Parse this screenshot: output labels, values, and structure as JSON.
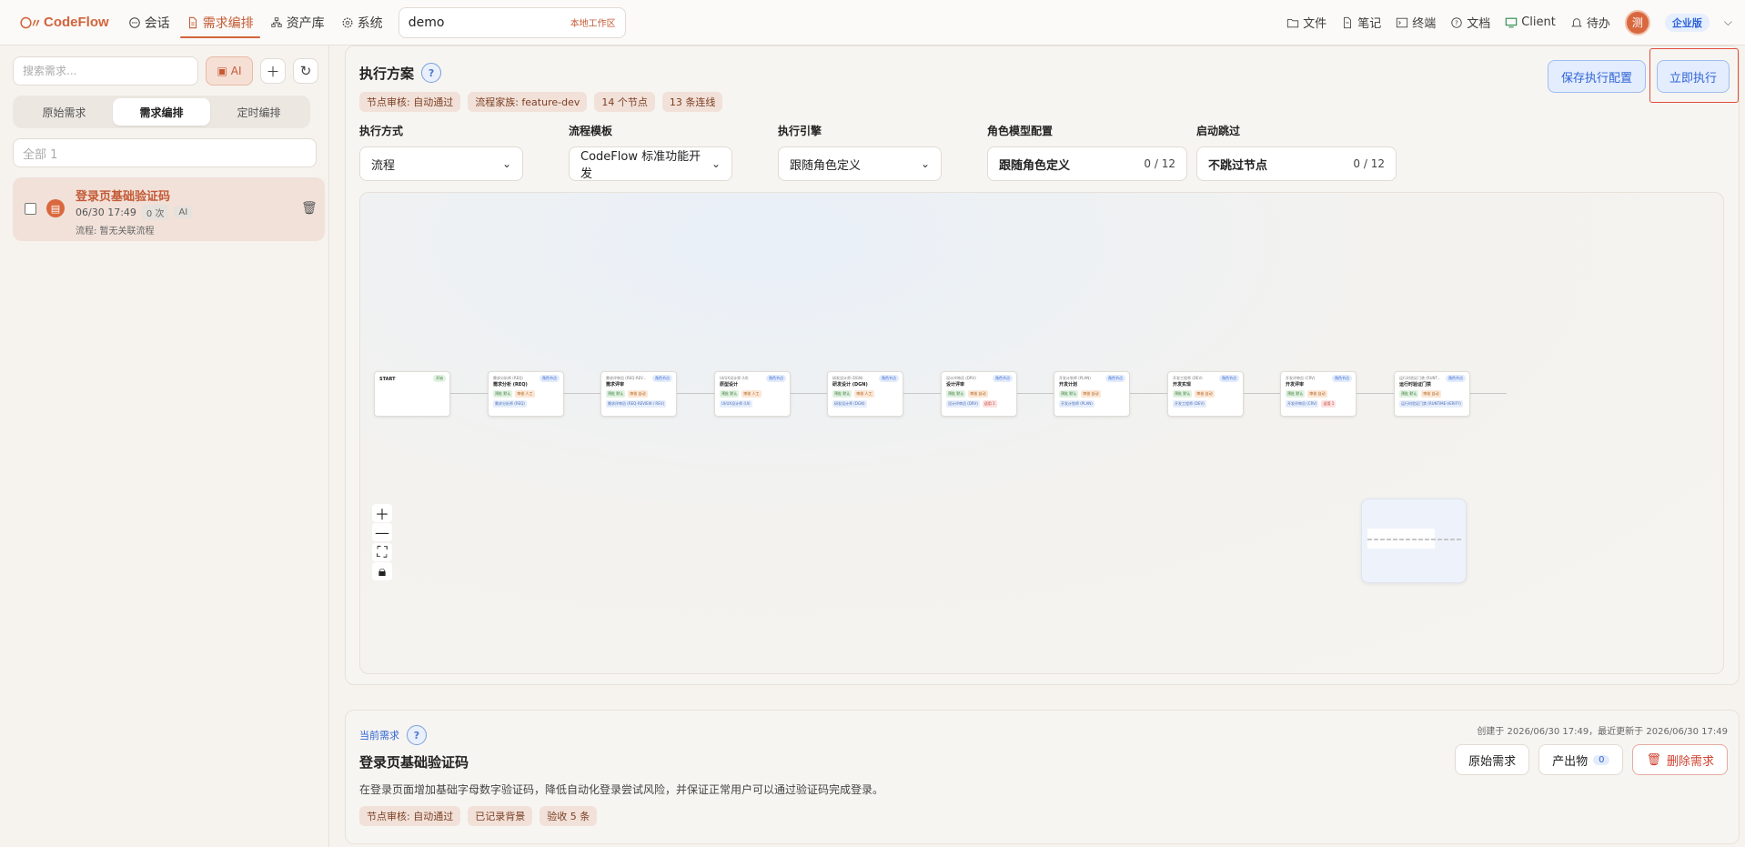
{
  "header": {
    "app_name": "CodeFlow",
    "nav": [
      {
        "label": "会话",
        "icon": "chat-icon"
      },
      {
        "label": "需求编排",
        "icon": "document-icon",
        "active": true
      },
      {
        "label": "资产库",
        "icon": "sitemap-icon"
      },
      {
        "label": "系统",
        "icon": "gear-icon"
      }
    ],
    "workspace": {
      "name": "demo",
      "tag": "本地工作区"
    },
    "tools": [
      {
        "label": "文件",
        "icon": "folder-icon"
      },
      {
        "label": "笔记",
        "icon": "note-icon"
      },
      {
        "label": "终端",
        "icon": "terminal-icon"
      },
      {
        "label": "文档",
        "icon": "help-icon"
      },
      {
        "label": "Client",
        "icon": "monitor-icon"
      },
      {
        "label": "待办",
        "icon": "bell-icon"
      }
    ],
    "avatar_text": "测",
    "edition": "企业版"
  },
  "sidebar": {
    "search_placeholder": "搜索需求...",
    "ai_label": "AI",
    "tabs": [
      "原始需求",
      "需求编排",
      "定时编排"
    ],
    "active_tab": 1,
    "filter_value": "全部 1",
    "requirement": {
      "title": "登录页基础验证码",
      "time": "06/30 17:49",
      "count": "0 次",
      "ai": "AI",
      "flow": "流程: 暂无关联流程"
    }
  },
  "plan": {
    "title": "执行方案",
    "tags": [
      "节点审核: 自动通过",
      "流程家族: feature-dev",
      "14 个节点",
      "13 条连线"
    ],
    "save_label": "保存执行配置",
    "run_label": "立即执行",
    "configs": {
      "mode": {
        "label": "执行方式",
        "value": "流程"
      },
      "template": {
        "label": "流程模板",
        "value": "CodeFlow 标准功能开发"
      },
      "engine": {
        "label": "执行引擎",
        "value": "跟随角色定义"
      },
      "role_model": {
        "label": "角色模型配置",
        "value": "跟随角色定义",
        "count": "0 / 12"
      },
      "skip": {
        "label": "启动跳过",
        "value": "不跳过节点",
        "count": "0 / 12"
      }
    }
  },
  "canvas": {
    "nodes": [
      {
        "kind": "",
        "title": "START",
        "badge": "开始",
        "chips": [],
        "links": []
      },
      {
        "kind": "需求分析师 (REQ)",
        "title": "需求分析 (REQ)",
        "badge": "角色节点",
        "chips": [
          "预批 默认",
          "审核 人工"
        ],
        "links": [
          "需求分析师 (REQ)"
        ]
      },
      {
        "kind": "需求评审员 (REQ-REV...",
        "title": "需求评审",
        "badge": "角色节点",
        "chips": [
          "预批 默认",
          "审核 自动"
        ],
        "links": [
          "需求评审员 (REQ-REVIEW / REV)"
        ]
      },
      {
        "kind": "UI/UX设计师 (UI)",
        "title": "原型设计",
        "badge": "角色节点",
        "chips": [
          "预批 默认",
          "审核 人工"
        ],
        "links": [
          "UI/UX设计师 (UI)"
        ]
      },
      {
        "kind": "研发设计师 (DGN)",
        "title": "研发设计 (DGN)",
        "badge": "角色节点",
        "chips": [
          "预批 默认",
          "审核 人工"
        ],
        "links": [
          "研发设计师 (DGN)"
        ]
      },
      {
        "kind": "设计评审员 (DRV)",
        "title": "设计评审",
        "badge": "角色节点",
        "chips": [
          "预批 默认",
          "审核 自动"
        ],
        "links": [
          "设计评审员 (DRV)",
          "适用 1"
        ]
      },
      {
        "kind": "开发计划师 (PLAN)",
        "title": "开发计划",
        "badge": "角色节点",
        "chips": [
          "预批 默认",
          "审核 自动"
        ],
        "links": [
          "开发计划师 (PLAN)"
        ]
      },
      {
        "kind": "开发工程师 (DEV)",
        "title": "开发实现",
        "badge": "角色节点",
        "chips": [
          "预批 默认",
          "审核 自动"
        ],
        "links": [
          "开发工程师 (DEV)"
        ]
      },
      {
        "kind": "开发评审员 (CRV)",
        "title": "开发评审",
        "badge": "角色节点",
        "chips": [
          "预批 默认",
          "审核 自动"
        ],
        "links": [
          "开发评审员 (CRV)",
          "适用 1"
        ]
      },
      {
        "kind": "运行时验证门禁 (RUNT...",
        "title": "运行时验证门禁",
        "badge": "角色节点",
        "chips": [
          "预批 默认",
          "审核 自动"
        ],
        "links": [
          "运行时验证门禁 (RUNTIME-VERIFY)"
        ]
      }
    ]
  },
  "current": {
    "label": "当前需求",
    "title": "登录页基础验证码",
    "description": "在登录页面增加基础字母数字验证码，降低自动化登录尝试风险，并保证正常用户可以通过验证码完成登录。",
    "tags": [
      "节点审核: 自动通过",
      "已记录背景",
      "验收 5 条"
    ],
    "timestamps": "创建于 2026/06/30 17:49，最近更新于 2026/06/30 17:49",
    "btn_original": "原始需求",
    "btn_output": "产出物",
    "output_count": "0",
    "btn_delete": "删除需求"
  },
  "colors": {
    "accent": "#d2643c",
    "link_blue": "#2f63d6"
  }
}
